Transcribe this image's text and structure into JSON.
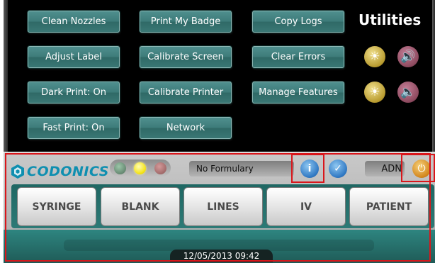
{
  "utilities": {
    "title": "Utilities",
    "buttons": {
      "clean_nozzles": "Clean Nozzles",
      "print_my_badge": "Print My Badge",
      "copy_logs": "Copy Logs",
      "adjust_label": "Adjust Label",
      "calibrate_screen": "Calibrate Screen",
      "clear_errors": "Clear Errors",
      "dark_print": "Dark Print: On",
      "calibrate_printer": "Calibrate Printer",
      "manage_features": "Manage Features",
      "fast_print": "Fast Print: On",
      "network": "Network"
    },
    "icons": [
      "brightness-icon",
      "volume-icon"
    ]
  },
  "status_bar": {
    "logo": "CODONICS",
    "status_lights": [
      "green",
      "yellow",
      "red"
    ],
    "formulary": "No Formulary",
    "user": "ADN",
    "icons": [
      "info-icon",
      "help-icon",
      "power-icon"
    ]
  },
  "tabs": [
    {
      "label": "SYRINGE"
    },
    {
      "label": "BLANK"
    },
    {
      "label": "LINES"
    },
    {
      "label": "IV"
    },
    {
      "label": "PATIENT"
    }
  ],
  "footer": {
    "datetime": "12/05/2013 09:42"
  },
  "colors": {
    "button_teal": "#3d7b79",
    "highlight_red": "#d9161b",
    "logo_blue": "#0f8fb0"
  }
}
